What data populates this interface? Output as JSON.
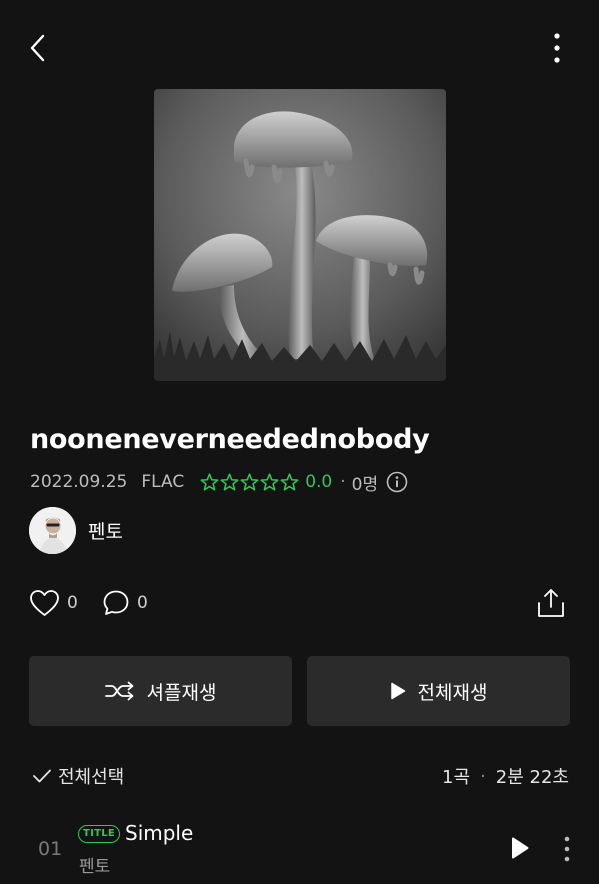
{
  "album": {
    "title": "noonenever neededno body",
    "release_date": "2022.09.25",
    "format": "FLAC",
    "rating": "0.0",
    "rating_stars": 0,
    "rating_count": "0명",
    "artist": "펜토"
  },
  "stats": {
    "likes": "0",
    "comments": "0"
  },
  "buttons": {
    "shuffle_label": "셔플재생",
    "play_all_label": "전체재생"
  },
  "list_header": {
    "select_all_label": "전체선택",
    "track_count": "1곡",
    "total_duration": "2분 22초"
  },
  "tracks": [
    {
      "number": "01",
      "badge": "TITLE",
      "title": "Simple",
      "artist": "펜토"
    }
  ],
  "icons": {
    "back": "chevron-left-icon",
    "more": "more-vertical-icon",
    "star": "star-outline-icon",
    "info": "info-icon",
    "like": "heart-icon",
    "comment": "comment-icon",
    "share": "share-icon",
    "shuffle": "shuffle-icon",
    "play": "play-icon",
    "check": "check-icon"
  },
  "colors": {
    "background": "#131313",
    "button_bg": "#2b2b2b",
    "accent_green": "#2ec75a",
    "secondary_text": "#9a9a9a"
  }
}
